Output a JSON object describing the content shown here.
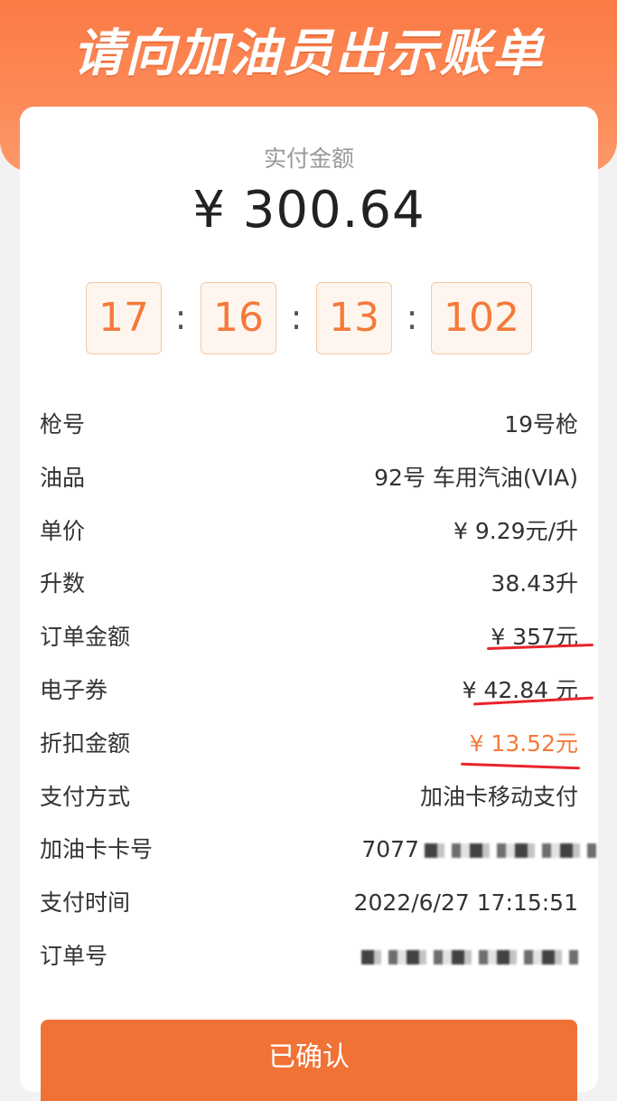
{
  "banner": {
    "title": "请向加油员出示账单"
  },
  "payment": {
    "label": "实付金额",
    "amount": "¥ 300.64"
  },
  "timer": {
    "h": "17",
    "m": "16",
    "s": "13",
    "ms": "102",
    "sep": ":"
  },
  "details": {
    "rows": [
      {
        "label": "枪号",
        "value": "19号枪"
      },
      {
        "label": "油品",
        "value": "92号 车用汽油(VIA)"
      },
      {
        "label": "单价",
        "value": "¥ 9.29元/升"
      },
      {
        "label": "升数",
        "value": "38.43升"
      },
      {
        "label": "订单金额",
        "value": "¥ 357元"
      },
      {
        "label": "电子券",
        "value": "¥ 42.84 元"
      },
      {
        "label": "折扣金额",
        "value": "¥ 13.52元"
      },
      {
        "label": "支付方式",
        "value": "加油卡移动支付"
      },
      {
        "label": "加油卡卡号",
        "value": "7077"
      },
      {
        "label": "支付时间",
        "value": "2022/6/27 17:15:51"
      },
      {
        "label": "订单号",
        "value": ""
      }
    ]
  },
  "confirm": {
    "label": "已确认"
  },
  "colors": {
    "accent": "#f17235",
    "highlight": "#f47a3a",
    "annotation": "#e8242c"
  }
}
